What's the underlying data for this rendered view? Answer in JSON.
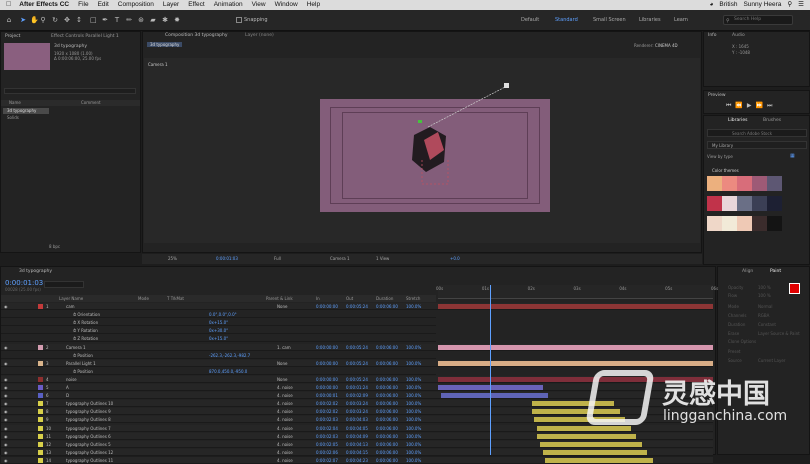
{
  "menubar": {
    "app_name": "After Effects CC",
    "items": [
      "File",
      "Edit",
      "Composition",
      "Layer",
      "Effect",
      "Animation",
      "View",
      "Window",
      "Help"
    ],
    "right": {
      "input_source": "British",
      "user": "Sunny Heera"
    }
  },
  "toolbar": {
    "snapping_label": "Snapping",
    "workspaces": [
      "Default",
      "Standard",
      "Small Screen",
      "Libraries",
      "Learn"
    ],
    "active_workspace": "Standard",
    "search_placeholder": "Search Help"
  },
  "project_panel": {
    "tab": "Project",
    "effect_tab": "Effect Controls Parallel Light 1",
    "item_name": "3d typography",
    "item_info1": "1920 x 1080 (1.00)",
    "item_info2": "Δ 0:00:06:00, 25.00 fps",
    "name_header": "Name",
    "comment_header": "Comment",
    "items": [
      "3d typography",
      "Solids"
    ],
    "bpc": "8 bpc"
  },
  "viewer": {
    "comp_tab": "Composition 3d typography",
    "layer_tab": "Layer (none)",
    "breadcrumb": "3d typography",
    "renderer_label": "Renderer:",
    "renderer_value": "CINEMA 4D",
    "camera_label": "Camera 1",
    "footer": {
      "zoom": "25%",
      "time": "0:00:01:03",
      "resolution": "Full",
      "view": "Camera 1",
      "views": "1 View",
      "exposure": "+0.0"
    }
  },
  "right_panels": {
    "info_tab": "Info",
    "audio_tab": "Audio",
    "coords": [
      "X : 1645",
      "Y : -1048"
    ],
    "preview_tab": "Preview",
    "libraries_tab": "Libraries",
    "brushes_tab": "Brushes",
    "lib_search": "Search Adobe Stock",
    "my_library": "My Library",
    "view_by": "View by type",
    "color_themes": "Color themes",
    "themes": [
      [
        "#ecb07e",
        "#ec8a80",
        "#d86d7a",
        "#9e5a76",
        "#5d5773"
      ],
      [
        "#c1334a",
        "#e9d6da",
        "#6a6f86",
        "#3b3f55",
        "#1d2033"
      ],
      [
        "#efd7c8",
        "#f2ead8",
        "#efc9b5",
        "#3b2c2c",
        "#141414"
      ]
    ],
    "align_tab": "Align",
    "paint_tab": "Paint",
    "paint_rows": [
      "Opacity",
      "Flow",
      "Mode",
      "Channels",
      "Duration",
      "Erase",
      "Clone Options",
      "Preset",
      "Source"
    ],
    "paint_values": [
      "100 %",
      "100 %",
      "Normal",
      "RGBA",
      "Constant",
      "Layer Source & Paint",
      "",
      "",
      "Current Layer"
    ]
  },
  "timeline": {
    "tab": "3d typography",
    "timecode": "0:00:01:03",
    "sub_timecode": "00028 (25.00 fps)",
    "search_placeholder": "",
    "headers": [
      "Layer Name",
      "Mode",
      "T TrkMat",
      "Parent & Link",
      "In",
      "Out",
      "Duration",
      "Stretch"
    ],
    "ruler": [
      "00s",
      "01s",
      "02s",
      "03s",
      "04s",
      "05s",
      "06s"
    ],
    "rows": [
      {
        "num": "1",
        "name": "cam",
        "type": "layer",
        "parent": "None",
        "in": "0:00:00:00",
        "out": "0:00:05:24",
        "dur": "0:00:06:00",
        "stretch": "100.0%",
        "color": "#c23a3a",
        "bar_color": "#8c3535",
        "bar_start": 0.0,
        "bar_end": 1.0
      },
      {
        "num": "",
        "name": "Orientation",
        "type": "prop",
        "value": "0.0°,0.0°,0.0°"
      },
      {
        "num": "",
        "name": "X Rotation",
        "type": "prop",
        "value": "0x+15.0°"
      },
      {
        "num": "",
        "name": "Y Rotation",
        "type": "prop",
        "value": "0x+30.0°"
      },
      {
        "num": "",
        "name": "Z Rotation",
        "type": "prop",
        "value": "0x+15.0°"
      },
      {
        "num": "2",
        "name": "Camera 1",
        "type": "layer",
        "parent": "1. cam",
        "in": "0:00:00:00",
        "out": "0:00:05:24",
        "dur": "0:00:06:00",
        "stretch": "100.0%",
        "color": "#d49db1",
        "bar_color": "#d495ad",
        "bar_start": 0.0,
        "bar_end": 1.0
      },
      {
        "num": "",
        "name": "Position",
        "type": "prop",
        "value": "-262.3,-262.3,-982.7"
      },
      {
        "num": "3",
        "name": "Parallel Light 1",
        "type": "layer",
        "parent": "None",
        "in": "0:00:00:00",
        "out": "0:00:05:24",
        "dur": "0:00:06:00",
        "stretch": "100.0%",
        "color": "#d9b48b",
        "bar_color": "#d8ad86",
        "bar_start": 0.0,
        "bar_end": 1.0
      },
      {
        "num": "",
        "name": "Position",
        "type": "prop",
        "value": "870.0,450.0,-950.0"
      },
      {
        "num": "4",
        "name": "noise",
        "type": "layer",
        "parent": "None",
        "in": "0:00:00:00",
        "out": "0:00:05:24",
        "dur": "0:00:06:00",
        "stretch": "100.0%",
        "color": "#8e2f2f",
        "bar_color": "#7f2e3a",
        "bar_start": 0.0,
        "bar_end": 1.0
      },
      {
        "num": "5",
        "name": "A",
        "type": "layer",
        "parent": "4. noise",
        "in": "0:00:00:00",
        "out": "0:00:01:24",
        "dur": "0:00:06:00",
        "stretch": "100.0%",
        "color": "#6b5cc7",
        "bar_color": "#6a62b8",
        "bar_start": 0.0,
        "bar_end": 0.38
      },
      {
        "num": "6",
        "name": "D",
        "type": "layer",
        "parent": "4. noise",
        "in": "0:00:00:01",
        "out": "0:00:02:09",
        "dur": "0:00:06:00",
        "stretch": "100.0%",
        "color": "#5960c4",
        "bar_color": "#5f64b6",
        "bar_start": 0.01,
        "bar_end": 0.4
      },
      {
        "num": "7",
        "name": "typography Outlines 10",
        "type": "layer",
        "parent": "4. noise",
        "in": "0:00:02:02",
        "out": "0:00:03:24",
        "dur": "0:00:06:00",
        "stretch": "100.0%",
        "color": "#d8d04a",
        "bar_color": "#bfb24a",
        "bar_start": 0.34,
        "bar_end": 0.64
      },
      {
        "num": "8",
        "name": "typography Outlines 9",
        "type": "layer",
        "parent": "4. noise",
        "in": "0:00:02:02",
        "out": "0:00:03:24",
        "dur": "0:00:06:00",
        "stretch": "100.0%",
        "color": "#d8d04a",
        "bar_color": "#bfb24a",
        "bar_start": 0.34,
        "bar_end": 0.66
      },
      {
        "num": "9",
        "name": "typography Outlines 8",
        "type": "layer",
        "parent": "4. noise",
        "in": "0:00:02:03",
        "out": "0:00:04:03",
        "dur": "0:00:06:00",
        "stretch": "100.0%",
        "color": "#d8d04a",
        "bar_color": "#bfb24a",
        "bar_start": 0.35,
        "bar_end": 0.68
      },
      {
        "num": "10",
        "name": "typography Outlines 7",
        "type": "layer",
        "parent": "4. noise",
        "in": "0:00:02:04",
        "out": "0:00:04:05",
        "dur": "0:00:06:00",
        "stretch": "100.0%",
        "color": "#d8d04a",
        "bar_color": "#bfb24a",
        "bar_start": 0.36,
        "bar_end": 0.7
      },
      {
        "num": "11",
        "name": "typography Outlines 6",
        "type": "layer",
        "parent": "4. noise",
        "in": "0:00:02:03",
        "out": "0:00:04:09",
        "dur": "0:00:06:00",
        "stretch": "100.0%",
        "color": "#d8d04a",
        "bar_color": "#bfb24a",
        "bar_start": 0.36,
        "bar_end": 0.72
      },
      {
        "num": "12",
        "name": "typography Outlines 5",
        "type": "layer",
        "parent": "4. noise",
        "in": "0:00:02:05",
        "out": "0:00:04:13",
        "dur": "0:00:06:00",
        "stretch": "100.0%",
        "color": "#d8d04a",
        "bar_color": "#bfb24a",
        "bar_start": 0.37,
        "bar_end": 0.74
      },
      {
        "num": "13",
        "name": "typography Outlines 12",
        "type": "layer",
        "parent": "4. noise",
        "in": "0:00:02:06",
        "out": "0:00:04:15",
        "dur": "0:00:06:00",
        "stretch": "100.0%",
        "color": "#d8d04a",
        "bar_color": "#bfb24a",
        "bar_start": 0.38,
        "bar_end": 0.76
      },
      {
        "num": "14",
        "name": "typography Outlines 11",
        "type": "layer",
        "parent": "4. noise",
        "in": "0:00:02:07",
        "out": "0:00:04:23",
        "dur": "0:00:06:00",
        "stretch": "100.0%",
        "color": "#d8d04a",
        "bar_color": "#bfb24a",
        "bar_start": 0.39,
        "bar_end": 0.78
      }
    ],
    "playhead": 0.19,
    "modes": [
      "Normal",
      "4. noise"
    ]
  },
  "watermark": {
    "brand_cn": "灵感中国",
    "url": "lingganchina.com"
  }
}
